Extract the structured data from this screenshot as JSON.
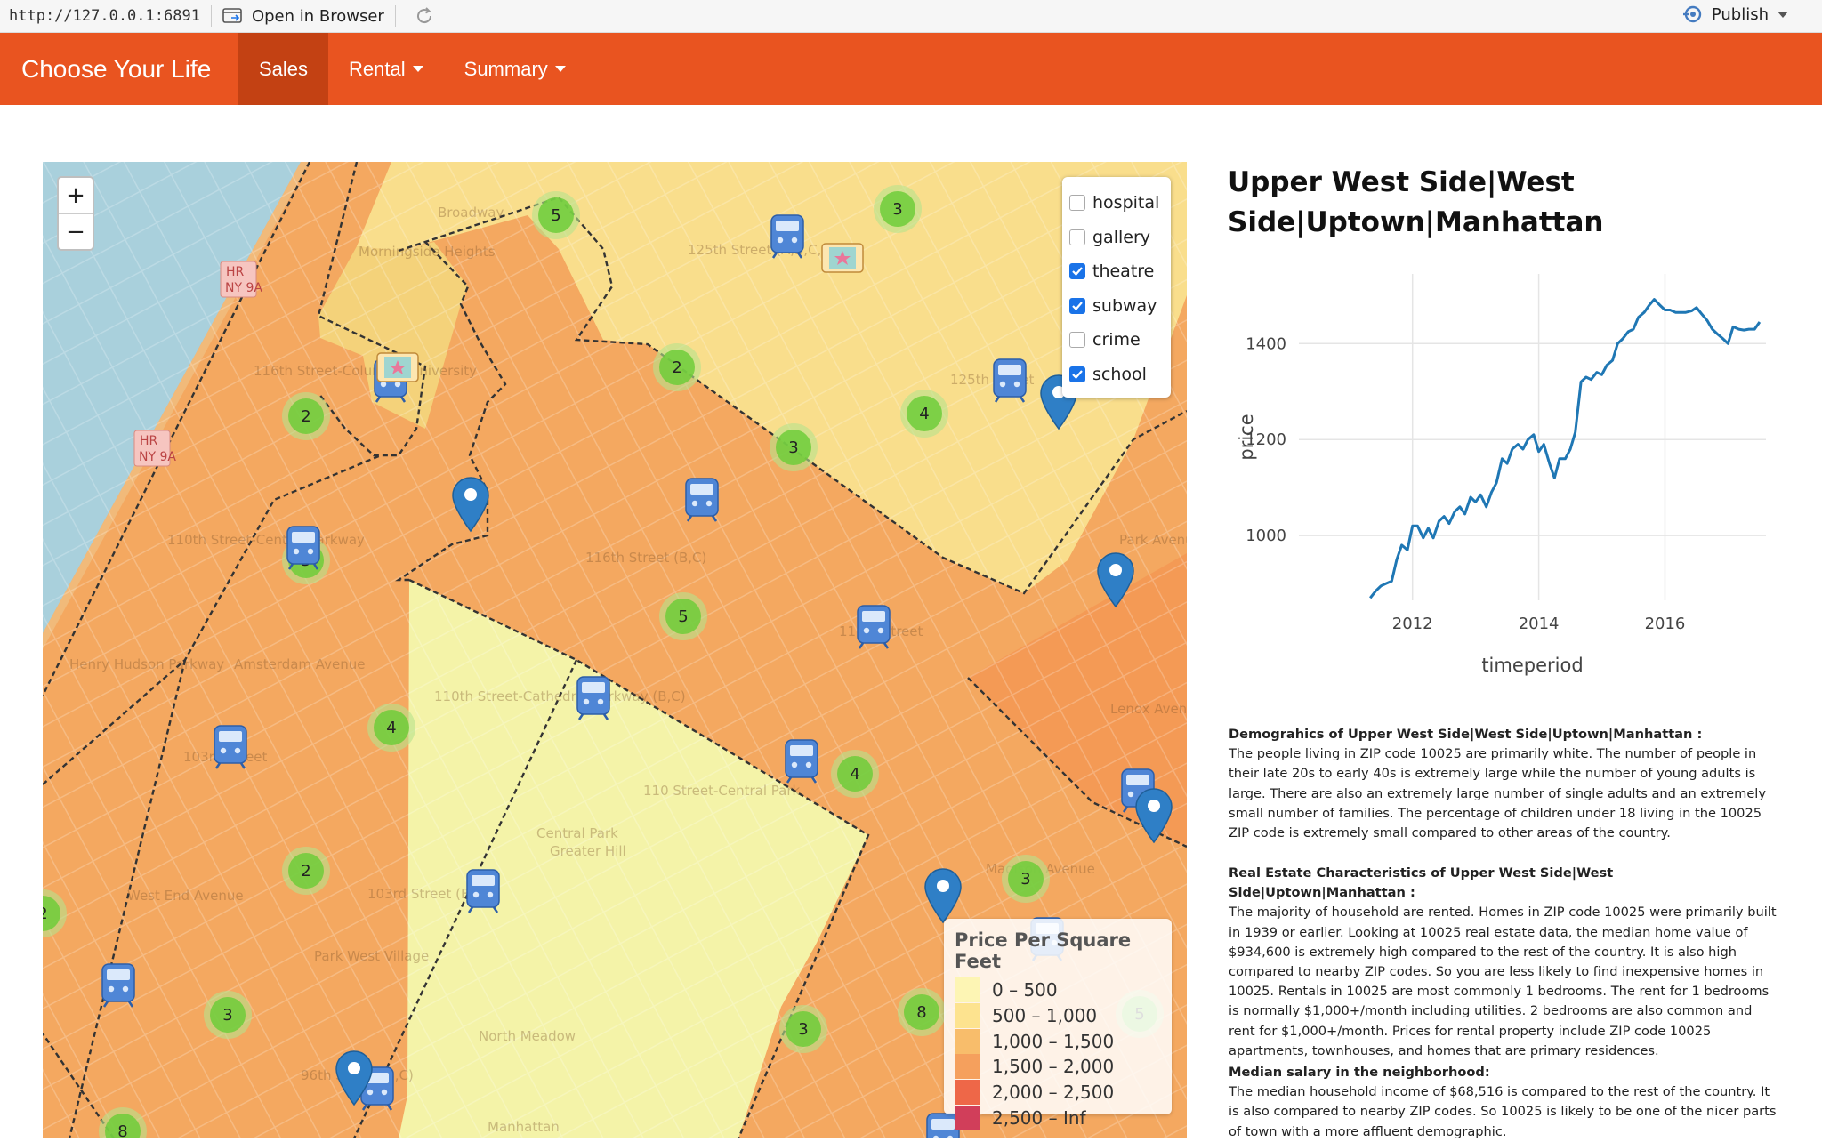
{
  "browser": {
    "url": "http://127.0.0.1:6891",
    "open_in_browser": "Open in Browser",
    "publish": "Publish"
  },
  "navbar": {
    "brand": "Choose Your Life",
    "items": [
      {
        "label": "Sales",
        "active": true
      },
      {
        "label": "Rental",
        "dropdown": true
      },
      {
        "label": "Summary",
        "dropdown": true
      }
    ]
  },
  "map": {
    "zoom_in": "+",
    "zoom_out": "−",
    "layers": [
      {
        "label": "hospital",
        "checked": false
      },
      {
        "label": "gallery",
        "checked": false
      },
      {
        "label": "theatre",
        "checked": true
      },
      {
        "label": "subway",
        "checked": true
      },
      {
        "label": "crime",
        "checked": false
      },
      {
        "label": "school",
        "checked": true
      }
    ],
    "legend": {
      "title": "Price Per Square Feet",
      "items": [
        {
          "label": "0 – 500",
          "color": "#fdf5b4"
        },
        {
          "label": "500 – 1,000",
          "color": "#fde38f"
        },
        {
          "label": "1,000 – 1,500",
          "color": "#f8bd6b"
        },
        {
          "label": "1,500 – 2,000",
          "color": "#f5a05d"
        },
        {
          "label": "2,000 – 2,500",
          "color": "#ee6748"
        },
        {
          "label": "2,500 – Inf",
          "color": "#d13e5a"
        }
      ]
    },
    "streets": [
      "Morningside Heights",
      "125th Street (A,B,C,D)",
      "116th Street-Columbia University",
      "110th Street-Central Parkway",
      "116th Street (B,C)",
      "110th Street-Cathedral Parkway (B,C)",
      "103rd Street",
      "110 Street-Central Park",
      "103rd Street (B,C)",
      "Park West Village",
      "Central Park",
      "North Meadow",
      "96th Street (B,C)",
      "Manhattan",
      "116th Street",
      "125th Street",
      "Amsterdam Avenue",
      "Broadway",
      "West End Avenue",
      "Madison Avenue",
      "Henry Hudson Parkway",
      "Greater Hill",
      "Lenox Avenue",
      "Park Avenue"
    ],
    "badges": [
      "HR",
      "NY 9A",
      "HR",
      "NY 9A"
    ],
    "clusters": [
      {
        "count": "5"
      },
      {
        "count": "3"
      },
      {
        "count": "2"
      },
      {
        "count": "2"
      },
      {
        "count": "4"
      },
      {
        "count": "3"
      },
      {
        "count": "5"
      },
      {
        "count": "5"
      },
      {
        "count": "4"
      },
      {
        "count": "4"
      },
      {
        "count": "2"
      },
      {
        "count": "2"
      },
      {
        "count": "3"
      },
      {
        "count": "3"
      },
      {
        "count": "3"
      },
      {
        "count": "8"
      },
      {
        "count": "8"
      },
      {
        "count": "5"
      }
    ]
  },
  "panel": {
    "title": "Upper West Side|West Side|Uptown|Manhattan",
    "sections": [
      {
        "heading": "Demograhics of Upper West Side|West Side|Uptown|Manhattan :",
        "body": "The people living in ZIP code 10025 are primarily white. The number of people in their late 20s to early 40s is extremely large while the number of young adults is large. There are also an extremely large number of single adults and an extremely small number of families. The percentage of children under 18 living in the 10025 ZIP code is extremely small compared to other areas of the country."
      },
      {
        "heading": "Real Estate Characteristics of Upper West Side|West Side|Uptown|Manhattan :",
        "body": "The majority of household are rented. Homes in ZIP code 10025 were primarily built in 1939 or earlier. Looking at 10025 real estate data, the median home value of $934,600 is extremely high compared to the rest of the country. It is also high compared to nearby ZIP codes. So you are less likely to find inexpensive homes in 10025. Rentals in 10025 are most commonly 1 bedrooms. The rent for 1 bedrooms is normally $1,000+/month including utilities. 2 bedrooms are also common and rent for $1,000+/month. Prices for rental property include ZIP code 10025 apartments, townhouses, and homes that are primary residences."
      },
      {
        "heading": "Median salary in the neighborhood:",
        "body": "The median household income of $68,516 is compared to the rest of the country. It is also compared to nearby ZIP codes. So 10025 is likely to be one of the nicer parts of town with a more affluent demographic."
      }
    ]
  },
  "chart_data": {
    "type": "line",
    "xlabel": "timeperiod",
    "ylabel": "price",
    "xlim": [
      2010.2,
      2017.6
    ],
    "ylim": [
      865,
      1545
    ],
    "xticks": [
      2012,
      2014,
      2016
    ],
    "yticks": [
      1000,
      1200,
      1400
    ],
    "xtick_labels": [
      "2012",
      "2014",
      "2016"
    ],
    "ytick_labels": [
      "1000",
      "1200",
      "1400"
    ],
    "color": "#1f77b4",
    "grid": true,
    "x": [
      2011.33,
      2011.42,
      2011.5,
      2011.58,
      2011.67,
      2011.75,
      2011.83,
      2011.92,
      2012.0,
      2012.08,
      2012.17,
      2012.25,
      2012.33,
      2012.42,
      2012.5,
      2012.58,
      2012.67,
      2012.75,
      2012.83,
      2012.92,
      2013.0,
      2013.08,
      2013.17,
      2013.25,
      2013.33,
      2013.42,
      2013.5,
      2013.58,
      2013.67,
      2013.75,
      2013.83,
      2013.92,
      2014.0,
      2014.08,
      2014.17,
      2014.25,
      2014.33,
      2014.42,
      2014.5,
      2014.58,
      2014.67,
      2014.75,
      2014.83,
      2014.92,
      2015.0,
      2015.08,
      2015.17,
      2015.25,
      2015.33,
      2015.42,
      2015.5,
      2015.58,
      2015.67,
      2015.75,
      2015.83,
      2015.92,
      2016.0,
      2016.08,
      2016.17,
      2016.25,
      2016.33,
      2016.42,
      2016.5,
      2016.58,
      2016.67,
      2016.75,
      2016.83,
      2016.92,
      2017.0,
      2017.08,
      2017.17,
      2017.25,
      2017.33,
      2017.42,
      2017.5
    ],
    "y": [
      870,
      885,
      895,
      900,
      905,
      950,
      980,
      970,
      1020,
      1020,
      995,
      1015,
      995,
      1030,
      1040,
      1025,
      1050,
      1060,
      1045,
      1080,
      1070,
      1085,
      1060,
      1090,
      1110,
      1160,
      1150,
      1180,
      1190,
      1180,
      1200,
      1210,
      1175,
      1190,
      1150,
      1120,
      1160,
      1160,
      1180,
      1215,
      1320,
      1330,
      1325,
      1340,
      1335,
      1355,
      1365,
      1400,
      1410,
      1425,
      1430,
      1455,
      1465,
      1480,
      1492,
      1480,
      1470,
      1470,
      1465,
      1465,
      1465,
      1468,
      1475,
      1462,
      1448,
      1430,
      1420,
      1410,
      1400,
      1435,
      1430,
      1428,
      1430,
      1430,
      1445
    ]
  }
}
